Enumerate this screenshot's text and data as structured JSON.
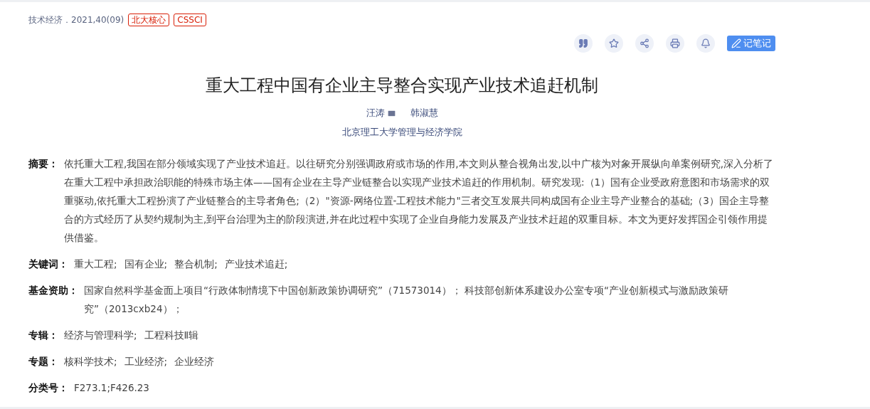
{
  "source": {
    "journal": "技术经济．2021,40(09)",
    "tags": [
      "北大核心",
      "CSSCI"
    ]
  },
  "toolbar": {
    "buttons": [
      {
        "kind": "quote"
      },
      {
        "kind": "favorite"
      },
      {
        "kind": "share"
      },
      {
        "kind": "print"
      },
      {
        "kind": "alert"
      }
    ],
    "note_button": "记笔记"
  },
  "title": "重大工程中国有企业主导整合实现产业技术追赶机制",
  "authors": [
    {
      "name": "汪涛",
      "has_email": true
    },
    {
      "name": "韩淑慧",
      "has_email": false
    }
  ],
  "affiliation": "北京理工大学管理与经济学院",
  "fields": [
    {
      "kind": "text",
      "label": "摘要：",
      "text": "依托重大工程,我国在部分领域实现了产业技术追赶。以往研究分别强调政府或市场的作用,本文则从整合视角出发,以中广核为对象开展纵向单案例研究,深入分析了在重大工程中承担政治职能的特殊市场主体——国有企业在主导产业链整合以实现产业技术追赶的作用机制。研究发现:（1）国有企业受政府意图和市场需求的双重驱动,依托重大工程扮演了产业链整合的主导者角色;（2）\"资源-网络位置-工程技术能力\"三者交互发展共同构成国有企业主导产业整合的基础;（3）国企主导整合的方式经历了从契约规制为主,到平台治理为主的阶段演进,并在此过程中实现了企业自身能力发展及产业技术赶超的双重目标。本文为更好发挥国企引领作用提供借鉴。"
    },
    {
      "kind": "links",
      "label": "关键词：",
      "items": [
        "重大工程;",
        "国有企业;",
        "整合机制;",
        "产业技术追赶;"
      ]
    },
    {
      "kind": "text",
      "label": "基金资助：",
      "text": "国家自然科学基金面上项目“行政体制情境下中国创新政策协调研究”（71573014）； 科技部创新体系建设办公室专项“产业创新模式与激励政策研究”（2013cxb24）；"
    },
    {
      "kind": "list",
      "label": "专辑：",
      "items": [
        "经济与管理科学;",
        "工程科技Ⅱ辑"
      ]
    },
    {
      "kind": "list",
      "label": "专题：",
      "items": [
        "核科学技术;",
        "工业经济;",
        "企业经济"
      ]
    },
    {
      "kind": "text",
      "label": "分类号：",
      "text": "F273.1;F426.23"
    }
  ]
}
